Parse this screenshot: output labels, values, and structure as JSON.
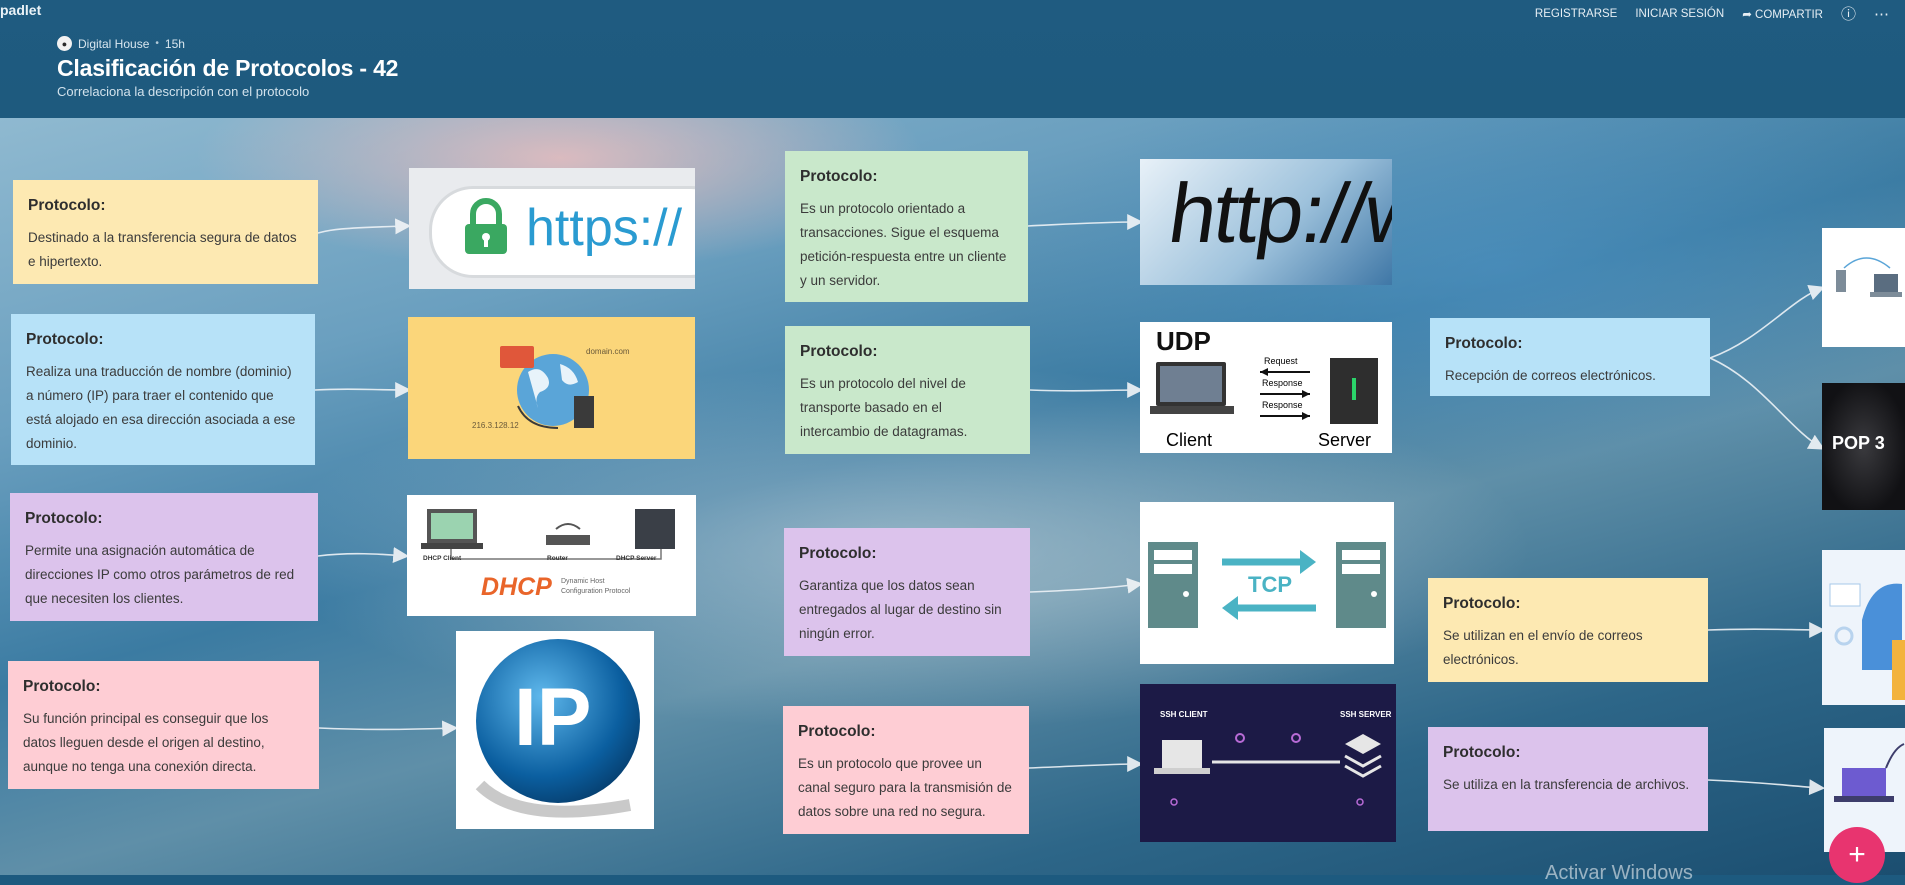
{
  "app": {
    "logo": "padlet"
  },
  "nav": {
    "register": "REGISTRARSE",
    "login": "INICIAR SESIÓN",
    "share": "COMPARTIR"
  },
  "board": {
    "owner": "Digital House",
    "age": "15h",
    "title": "Clasificación de Protocolos - 42",
    "subtitle": "Correlaciona la descripción con el protocolo"
  },
  "cards": [
    {
      "head": "Protocolo:",
      "text": "Destinado a la transferencia segura de datos e hipertexto.",
      "color": "#fde9b2"
    },
    {
      "head": "Protocolo:",
      "text": "Realiza una traducción de nombre (dominio) a número (IP) para traer el contenido que está alojado en esa dirección asociada a ese dominio.",
      "color": "#b7e2f8"
    },
    {
      "head": "Protocolo:",
      "text": "Permite una asignación automática de direcciones IP como otros parámetros de red que necesiten los clientes.",
      "color": "#dcc3ec"
    },
    {
      "head": "Protocolo:",
      "text": "Su función principal es conseguir que los datos lleguen desde el origen al destino, aunque no tenga una conexión directa.",
      "color": "#fecdd4"
    },
    {
      "head": "Protocolo:",
      "text": "Es un protocolo orientado a transacciones. Sigue el esquema petición-respuesta entre un cliente y un servidor.",
      "color": "#c9e8cb"
    },
    {
      "head": "Protocolo:",
      "text": "Es un protocolo del nivel de transporte basado en el intercambio de datagramas.",
      "color": "#c9e8cb"
    },
    {
      "head": "Protocolo:",
      "text": "Garantiza que los datos sean entregados al lugar de destino sin ningún error.",
      "color": "#dcc3ec"
    },
    {
      "head": "Protocolo:",
      "text": "Es un protocolo que provee un canal seguro para la transmisión de datos sobre una red no segura.",
      "color": "#fecdd4"
    },
    {
      "head": "Protocolo:",
      "text": "Recepción de correos electrónicos.",
      "color": "#b7e2f8"
    },
    {
      "head": "Protocolo:",
      "text": "Se utilizan en el envío de correos electrónicos.",
      "color": "#fde9b2"
    },
    {
      "head": "Protocolo:",
      "text": "Se utiliza en la transferencia de archivos.",
      "color": "#dcc3ec"
    }
  ],
  "images": {
    "https": {
      "text": "https://"
    },
    "dns": {
      "domain": "domain.com",
      "ip": "216.3.128.12"
    },
    "dhcp": {
      "client": "DHCP Client",
      "router": "Router",
      "server": "DHCP Server",
      "logo": "DHCP",
      "caption1": "Dynamic Host",
      "caption2": "Configuration Protocol"
    },
    "ip": {
      "text": "IP"
    },
    "http": {
      "text": "http://ww"
    },
    "udp": {
      "title": "UDP",
      "request": "Request",
      "response": "Response",
      "client": "Client",
      "server": "Server"
    },
    "tcp": {
      "text": "TCP"
    },
    "ssh": {
      "client": "SSH CLIENT",
      "server": "SSH SERVER"
    },
    "pop3": {
      "text": "POP 3"
    }
  },
  "fab": {
    "label": "+"
  },
  "watermark": "Activar Windows"
}
